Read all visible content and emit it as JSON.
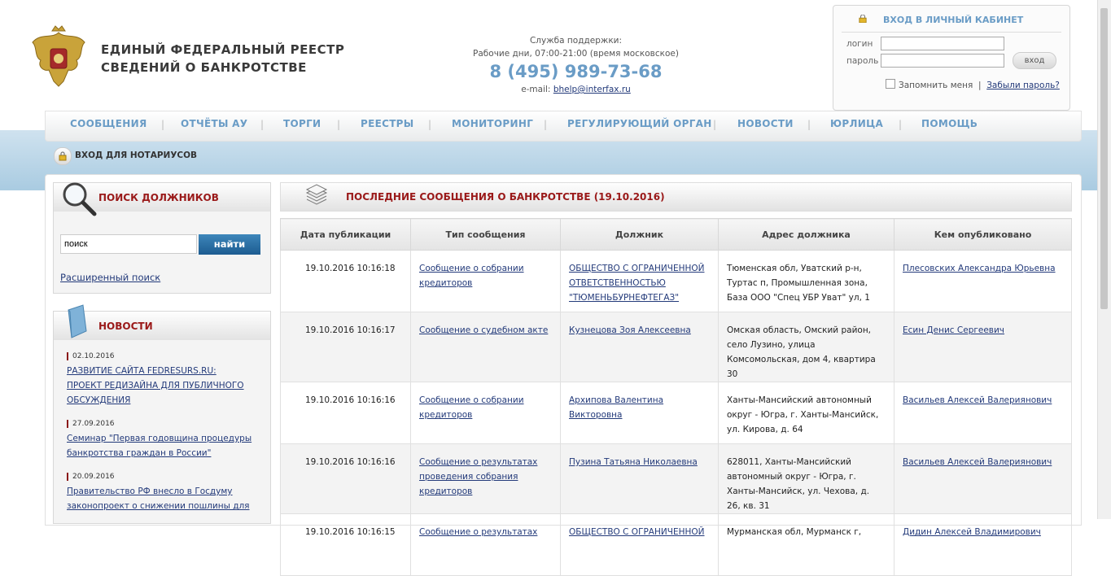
{
  "header": {
    "title_line1": "ЕДИНЫЙ  ФЕДЕРАЛЬНЫЙ  РЕЕСТР",
    "title_line2": "СВЕДЕНИЙ О БАНКРОТСТВЕ"
  },
  "support": {
    "label": "Служба поддержки:",
    "hours": "Рабочие дни, 07:00-21:00 (время московское)",
    "phone": "8 (495) 989-73-68",
    "email_label": "e-mail: ",
    "email": "bhelp@interfax.ru"
  },
  "login": {
    "title": "ВХОД В ЛИЧНЫЙ КАБИНЕТ",
    "login_label": "логин",
    "password_label": "пароль",
    "submit": "вход",
    "remember": "Запомнить меня",
    "separator": "|",
    "forgot": "Забыли пароль?"
  },
  "nav": {
    "items": [
      "СООБЩЕНИЯ",
      "ОТЧЁТЫ АУ",
      "ТОРГИ",
      "РЕЕСТРЫ",
      "МОНИТОРИНГ",
      "РЕГУЛИРУЮЩИЙ ОРГАН",
      "НОВОСТИ",
      "ЮРЛИЦА",
      "ПОМОЩЬ"
    ]
  },
  "notary_login": "ВХОД ДЛЯ НОТАРИУСОВ",
  "debtor_search": {
    "title": "ПОИСК ДОЛЖНИКОВ",
    "input_value": "поиск",
    "button": "найти",
    "advanced": "Расширенный поиск"
  },
  "news": {
    "title": "НОВОСТИ",
    "items": [
      {
        "date": "02.10.2016",
        "text": "РАЗВИТИЕ САЙТА FEDRESURS.RU: ПРОЕКТ РЕДИЗАЙНА ДЛЯ ПУБЛИЧНОГО ОБСУЖДЕНИЯ"
      },
      {
        "date": "27.09.2016",
        "text": "Семинар \"Первая годовщина процедуры банкротства граждан в России\""
      },
      {
        "date": "20.09.2016",
        "text": "Правительство РФ внесло в Госдуму законопроект о снижении пошлины для"
      }
    ]
  },
  "messages": {
    "title": "ПОСЛЕДНИЕ СООБЩЕНИЯ О БАНКРОТСТВЕ (19.10.2016)",
    "columns": [
      "Дата публикации",
      "Тип сообщения",
      "Должник",
      "Адрес должника",
      "Кем опубликовано"
    ],
    "rows": [
      {
        "date": "19.10.2016 10:16:18",
        "type": "Сообщение о собрании кредиторов",
        "debtor": "ОБЩЕСТВО С ОГРАНИЧЕННОЙ ОТВЕТСТВЕННОСТЬЮ \"ТЮМЕНЬБУРНЕФТЕГАЗ\"",
        "address": "Тюменская обл, Уватский р-н, Туртас п, Промышленная зона, База ООО \"Спец УБР Уват\" ул, 1",
        "publisher": "Плесовских Александра Юрьевна"
      },
      {
        "date": "19.10.2016 10:16:17",
        "type": "Сообщение о судебном акте",
        "debtor": "Кузнецова Зоя Алексеевна",
        "address": "Омская область, Омский район, село Лузино, улица Комсомольская, дом 4, квартира 30",
        "publisher": "Есин Денис Сергеевич"
      },
      {
        "date": "19.10.2016 10:16:16",
        "type": "Сообщение о собрании кредиторов",
        "debtor": "Архипова Валентина Викторовна",
        "address": "Ханты-Мансийский автономный округ - Югра, г. Ханты-Мансийск, ул. Кирова, д. 64",
        "publisher": "Васильев Алексей Валериянович"
      },
      {
        "date": "19.10.2016 10:16:16",
        "type": "Сообщение о результатах проведения собрания кредиторов",
        "debtor": "Пузина Татьяна Николаевна",
        "address": "628011, Ханты-Мансийский автономный округ - Югра, г. Ханты-Мансийск, ул. Чехова, д. 26, кв. 31",
        "publisher": "Васильев Алексей Валериянович"
      },
      {
        "date": "19.10.2016 10:16:15",
        "type": "Сообщение о результатах",
        "debtor": "ОБЩЕСТВО С ОГРАНИЧЕННОЙ",
        "address": "Мурманская обл, Мурманск г,",
        "publisher": "Дидин Алексей Владимирович"
      }
    ]
  },
  "colors": {
    "accent_blue": "#6a9cc6",
    "title_red": "#9a1919",
    "link": "#233a7a",
    "search_button": "#2a6fa5"
  },
  "icons": [
    "coat-of-arms-emblem",
    "lock-icon",
    "magnifier-icon",
    "book-icon",
    "stack-icon"
  ]
}
